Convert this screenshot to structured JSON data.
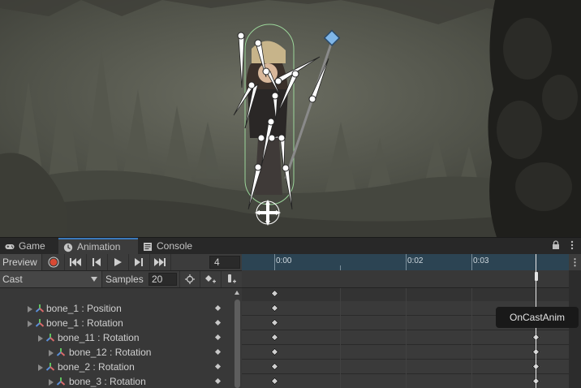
{
  "tabs": [
    {
      "label": "Game",
      "icon": "gamepad-icon"
    },
    {
      "label": "Animation",
      "icon": "clock-icon"
    },
    {
      "label": "Console",
      "icon": "console-icon"
    }
  ],
  "toolbar": {
    "preview_label": "Preview",
    "frame_value": "4"
  },
  "clip": {
    "selected": "Cast",
    "samples_label": "Samples",
    "samples_value": "20"
  },
  "properties": [
    {
      "label": "bone_1 : Position",
      "indent": 0
    },
    {
      "label": "bone_1 : Rotation",
      "indent": 0
    },
    {
      "label": "bone_11 : Rotation",
      "indent": 1
    },
    {
      "label": "bone_12 : Rotation",
      "indent": 2
    },
    {
      "label": "bone_2 : Rotation",
      "indent": 1
    },
    {
      "label": "bone_3 : Rotation",
      "indent": 2
    }
  ],
  "timeline": {
    "labels": [
      "0:00",
      "0:02",
      "0:03"
    ],
    "tooltip": "OnCastAnim"
  },
  "colors": {
    "accent": "#3a79bb",
    "record": "#d94a34",
    "ruler": "#2c4453"
  }
}
